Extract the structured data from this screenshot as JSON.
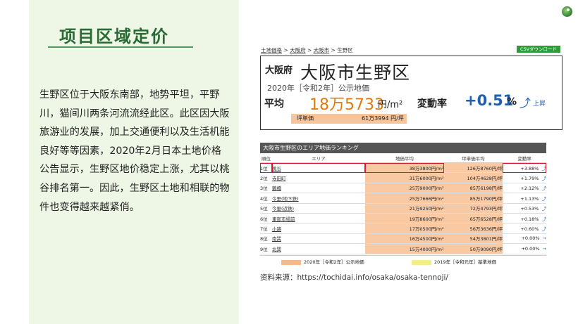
{
  "slide": {
    "title": "项目区域定价",
    "body": "生野区位于大阪东南部，地势平坦，平野川，猫间川两条河流流经此区。此区因大阪旅游业的发展，加上交通便利以及生活机能良好等等因素，2020年2月日本土地价格公告显示，生野区地价稳定上涨，尤其以桃谷排名第一。因此，生野区土地和相联的物件也变得越来越紧俏。",
    "source": "资料来源：https://tochidai.info/osaka/osaka-tennoji/"
  },
  "doc": {
    "breadcrumb": [
      "土地価格",
      "大阪府",
      "大阪市",
      "生野区"
    ],
    "breadcrumb_sep": ">",
    "csv_button": "CSVダウンロード",
    "pref": "大阪府",
    "city": "大阪市生野区",
    "year_line": "2020年［令和2年］公示地価",
    "avg_label": "平均",
    "avg_value": "18万5733",
    "avg_unit": "円/m²",
    "change_label": "変動率",
    "change_value": "+0.51",
    "change_unit": "%",
    "up_label": "上昇",
    "tsubo_label": "坪単価",
    "tsubo_value": "61万3994 円/坪",
    "ranking_title": "大阪市生野区のエリア地価ランキング",
    "columns": [
      "順位",
      "エリア",
      "地価平均",
      "坪単価平均",
      "変動率"
    ],
    "rows": [
      {
        "rank": "1位",
        "area": "桃谷",
        "avg": "38万3800円/m²",
        "tsubo": "126万8760円/坪",
        "change": "+3.88%",
        "arrow": "⤴"
      },
      {
        "rank": "2位",
        "area": "寺田町",
        "avg": "31万6000円/m²",
        "tsubo": "104万4628円/坪",
        "change": "+1.79%",
        "arrow": "⤴"
      },
      {
        "rank": "3位",
        "area": "鶴橋",
        "avg": "25万9000円/m²",
        "tsubo": "85万6198円/坪",
        "change": "+2.12%",
        "arrow": "⤴"
      },
      {
        "rank": "4位",
        "area": "今里(地下鉄)",
        "avg": "25万7666円/m²",
        "tsubo": "85万1790円/坪",
        "change": "+1.13%",
        "arrow": "⤴"
      },
      {
        "rank": "5位",
        "area": "今里(近鉄)",
        "avg": "21万9250円/m²",
        "tsubo": "72万4793円/坪",
        "change": "+0.53%",
        "arrow": "⤴"
      },
      {
        "rank": "6位",
        "area": "東部市場前",
        "avg": "19万8600円/m²",
        "tsubo": "65万6528円/坪",
        "change": "+0.18%",
        "arrow": "⤴"
      },
      {
        "rank": "7位",
        "area": "小路",
        "avg": "17万0500円/m²",
        "tsubo": "56万3636円/坪",
        "change": "+0.60%",
        "arrow": "⤴"
      },
      {
        "rank": "8位",
        "area": "南巽",
        "avg": "16万4500円/m²",
        "tsubo": "54万3801円/坪",
        "change": "+0.00%",
        "arrow": "→"
      },
      {
        "rank": "9位",
        "area": "北巽",
        "avg": "15万4000円/m²",
        "tsubo": "50万9090円/坪",
        "change": "+0.00%",
        "arrow": "→"
      }
    ],
    "legend": [
      {
        "label": "2020年［令和2年］公示地価",
        "color": "#f7b98a"
      },
      {
        "label": "2019年［令和元年］基準地価",
        "color": "#f3ee8a"
      }
    ]
  }
}
